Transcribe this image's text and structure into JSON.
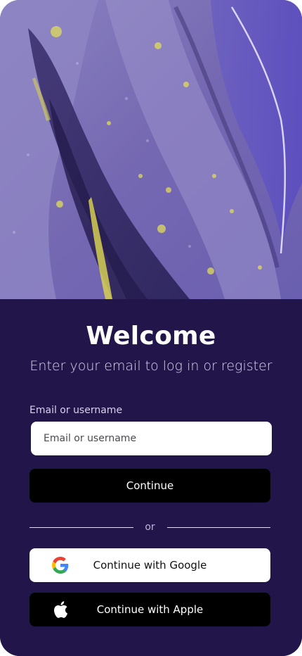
{
  "welcome": {
    "title": "Welcome",
    "subtitle": "Enter your email to log in or register"
  },
  "form": {
    "email_label": "Email or username",
    "email_placeholder": "Email or username",
    "email_value": "",
    "continue_label": "Continue"
  },
  "divider": {
    "text": "or"
  },
  "social": {
    "google_label": "Continue with Google",
    "google_icon": "google-icon",
    "apple_label": "Continue with Apple",
    "apple_icon": "apple-icon"
  },
  "colors": {
    "background": "#21154a",
    "hero_base": "#7a6fb4",
    "hero_accent": "#e0dc5a",
    "primary_button": "#000000",
    "google_button": "#ffffff"
  }
}
